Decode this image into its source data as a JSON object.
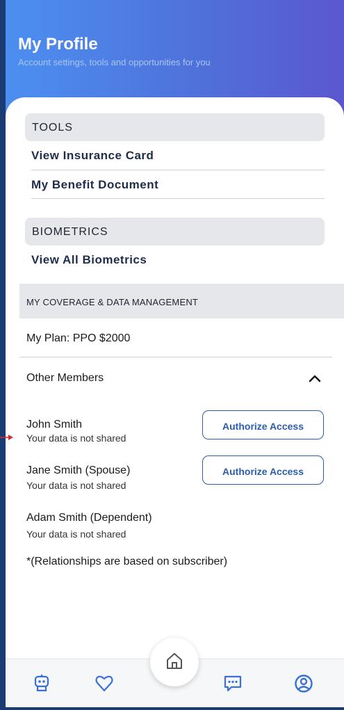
{
  "header": {
    "title": "My Profile",
    "subtitle": "Account settings, tools and opportunities for you"
  },
  "tools": {
    "heading": "TOOLS",
    "links": [
      "View Insurance Card",
      "My Benefit Document"
    ]
  },
  "biometrics": {
    "heading": "BIOMETRICS",
    "links": [
      "View All Biometrics"
    ]
  },
  "coverage": {
    "heading": "MY COVERAGE & DATA MANAGEMENT",
    "plan": "My Plan: PPO $2000",
    "other_members_label": "Other Members",
    "members": [
      {
        "name": "John Smith",
        "status": "Your data is not shared",
        "action": "Authorize Access"
      },
      {
        "name": "Jane Smith (Spouse)",
        "status": "Your data is not shared",
        "action": "Authorize Access"
      },
      {
        "name": "Adam Smith (Dependent)",
        "status": "Your data is not shared"
      }
    ],
    "note": "*(Relationships are based on subscriber)"
  },
  "nav": {
    "items": [
      "assistant-icon",
      "heart-icon",
      "home-icon",
      "chat-icon",
      "profile-icon"
    ],
    "accent_color": "#3a6fd8"
  },
  "colors": {
    "header_gradient_start": "#4c8ff1",
    "header_gradient_end": "#5b57cf",
    "link_color": "#1e2d4c",
    "button_border": "#2a5db0",
    "annotation_arrow": "#d62b2b"
  }
}
